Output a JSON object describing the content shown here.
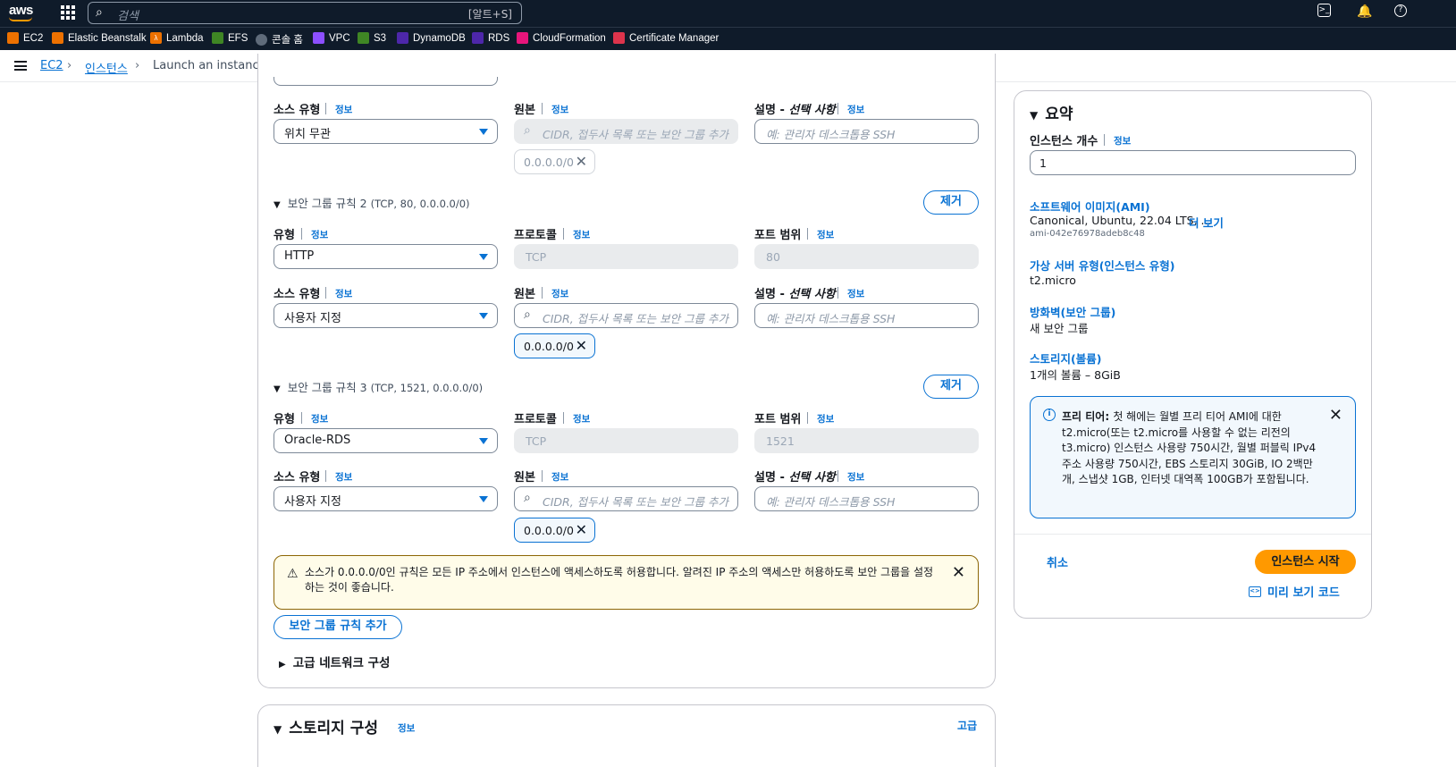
{
  "topbar": {
    "logo": "aws",
    "search_placeholder": "검색",
    "search_shortcut": "[알트+S]"
  },
  "bookmarks": [
    {
      "label": "EC2",
      "color": "#ed7100"
    },
    {
      "label": "Elastic Beanstalk",
      "color": "#ed7100"
    },
    {
      "label": "Lambda",
      "color": "#ed7100"
    },
    {
      "label": "EFS",
      "color": "#3f8624"
    },
    {
      "label": "콘솔 홈",
      "color": "#5f6b7a"
    },
    {
      "label": "VPC",
      "color": "#8c4fff"
    },
    {
      "label": "S3",
      "color": "#3f8624"
    },
    {
      "label": "DynamoDB",
      "color": "#4d27aa"
    },
    {
      "label": "RDS",
      "color": "#4d27aa"
    },
    {
      "label": "CloudFormation",
      "color": "#e7157b"
    },
    {
      "label": "Certificate Manager",
      "color": "#dd344c"
    }
  ],
  "breadcrumb": [
    "EC2",
    "인스턴스",
    "Launch an instance"
  ],
  "labels": {
    "source_type": "소스 유형",
    "source": "원본",
    "description": "설명 - ",
    "description_optional": "선택 사항",
    "type": "유형",
    "protocol": "프로토콜",
    "port_range": "포트 범위",
    "info": "정보",
    "remove": "제거",
    "cidr_placeholder": "CIDR, 접두사 목록 또는 보안 그룹 추가",
    "desc_placeholder": "예: 관리자 데스크톱용 SSH"
  },
  "rule1": {
    "source_type": "위치 무관",
    "token": "0.0.0.0/0"
  },
  "rule2": {
    "header": "보안 그룹 규칙 2",
    "header_detail": "(TCP, 80, 0.0.0.0/0)",
    "type": "HTTP",
    "protocol": "TCP",
    "port": "80",
    "source_type": "사용자 지정",
    "token": "0.0.0.0/0"
  },
  "rule3": {
    "header": "보안 그룹 규칙 3",
    "header_detail": "(TCP, 1521, 0.0.0.0/0)",
    "type": "Oracle-RDS",
    "protocol": "TCP",
    "port": "1521",
    "source_type": "사용자 지정",
    "token": "0.0.0.0/0"
  },
  "warning": "소스가 0.0.0.0/0인 규칙은 모든 IP 주소에서 인스턴스에 액세스하도록 허용합니다. 알려진 IP 주소의 액세스만 허용하도록 보안 그룹을 설정하는 것이 좋습니다.",
  "add_rule": "보안 그룹 규칙 추가",
  "advanced_network": "고급 네트워크 구성",
  "storage": {
    "title": "스토리지 구성",
    "info": "정보",
    "advanced": "고급"
  },
  "summary": {
    "title": "요약",
    "instance_count_label": "인스턴스 개수",
    "info": "정보",
    "instance_count": "1",
    "ami_link": "소프트웨어 이미지(AMI)",
    "ami_value": "Canonical, Ubuntu, 22.04 LTS, ...",
    "more": "더 보기",
    "ami_id": "ami-042e76978adeb8c48",
    "type_link": "가상 서버 유형(인스턴스 유형)",
    "type_value": "t2.micro",
    "fw_link": "방화벽(보안 그룹)",
    "fw_value": "새 보안 그룹",
    "storage_link": "스토리지(볼륨)",
    "storage_value": "1개의 볼륨 – 8GiB",
    "free_tier_title": "프리 티어: ",
    "free_tier_text": "첫 해에는 월별 프리 티어 AMI에 대한 t2.micro(또는 t2.micro를 사용할 수 없는 리전의 t3.micro) 인스턴스 사용량 750시간, 월별 퍼블릭 IPv4 주소 사용량 750시간, EBS 스토리지 30GiB, IO 2백만 개, 스냅샷 1GB, 인터넷 대역폭 100GB가 포함됩니다.",
    "cancel": "취소",
    "launch": "인스턴스 시작",
    "preview_code": "미리 보기 코드"
  }
}
